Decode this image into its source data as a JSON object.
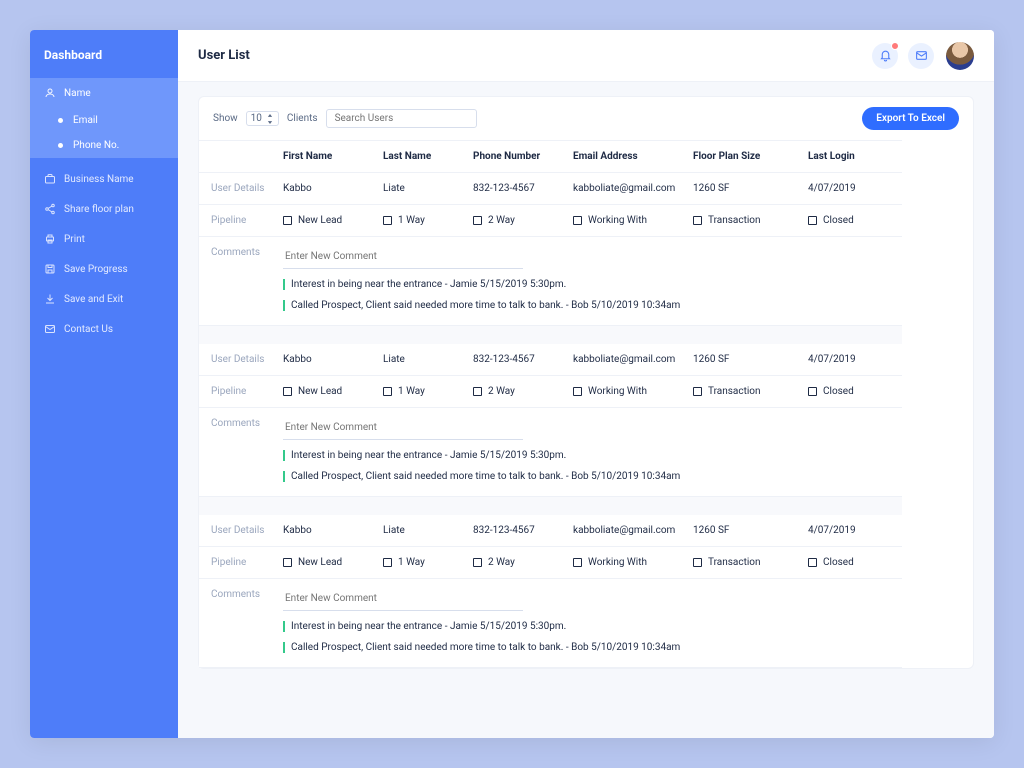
{
  "sidebar": {
    "title": "Dashboard",
    "items": [
      {
        "label": "Name",
        "sub": [
          "Email",
          "Phone No."
        ]
      },
      {
        "label": "Business Name"
      },
      {
        "label": "Share floor plan"
      },
      {
        "label": "Print"
      },
      {
        "label": "Save Progress"
      },
      {
        "label": "Save and Exit"
      },
      {
        "label": "Contact Us"
      }
    ]
  },
  "header": {
    "page_title": "User List"
  },
  "toolbar": {
    "show_label": "Show",
    "count": "10",
    "clients_label": "Clients",
    "search_placeholder": "Search Users",
    "export_label": "Export To Excel"
  },
  "columns": {
    "first_name": "First Name",
    "last_name": "Last Name",
    "phone": "Phone Number",
    "email": "Email Address",
    "plan": "Floor Plan Size",
    "login": "Last Login"
  },
  "row_labels": {
    "user_details": "User Details",
    "pipeline": "Pipeline",
    "comments": "Comments"
  },
  "pipeline_opts": [
    "New Lead",
    "1 Way",
    "2 Way",
    "Working With",
    "Transaction",
    "Closed"
  ],
  "comment_placeholder": "Enter New Comment",
  "records": [
    {
      "first_name": "Kabbo",
      "last_name": "Liate",
      "phone": "832-123-4567",
      "email": "kabboliate@gmail.com",
      "plan": "1260 SF",
      "login": "4/07/2019",
      "comments": [
        "Interest in being near the entrance - Jamie 5/15/2019 5:30pm.",
        "Called Prospect, Client said needed more time to talk to bank. - Bob 5/10/2019 10:34am"
      ]
    },
    {
      "first_name": "Kabbo",
      "last_name": "Liate",
      "phone": "832-123-4567",
      "email": "kabboliate@gmail.com",
      "plan": "1260 SF",
      "login": "4/07/2019",
      "comments": [
        "Interest in being near the entrance - Jamie 5/15/2019 5:30pm.",
        "Called Prospect, Client said needed more time to talk to bank. - Bob 5/10/2019 10:34am"
      ]
    },
    {
      "first_name": "Kabbo",
      "last_name": "Liate",
      "phone": "832-123-4567",
      "email": "kabboliate@gmail.com",
      "plan": "1260 SF",
      "login": "4/07/2019",
      "comments": [
        "Interest in being near the entrance - Jamie 5/15/2019 5:30pm.",
        "Called Prospect, Client said needed more time to talk to bank. - Bob 5/10/2019 10:34am"
      ]
    }
  ]
}
